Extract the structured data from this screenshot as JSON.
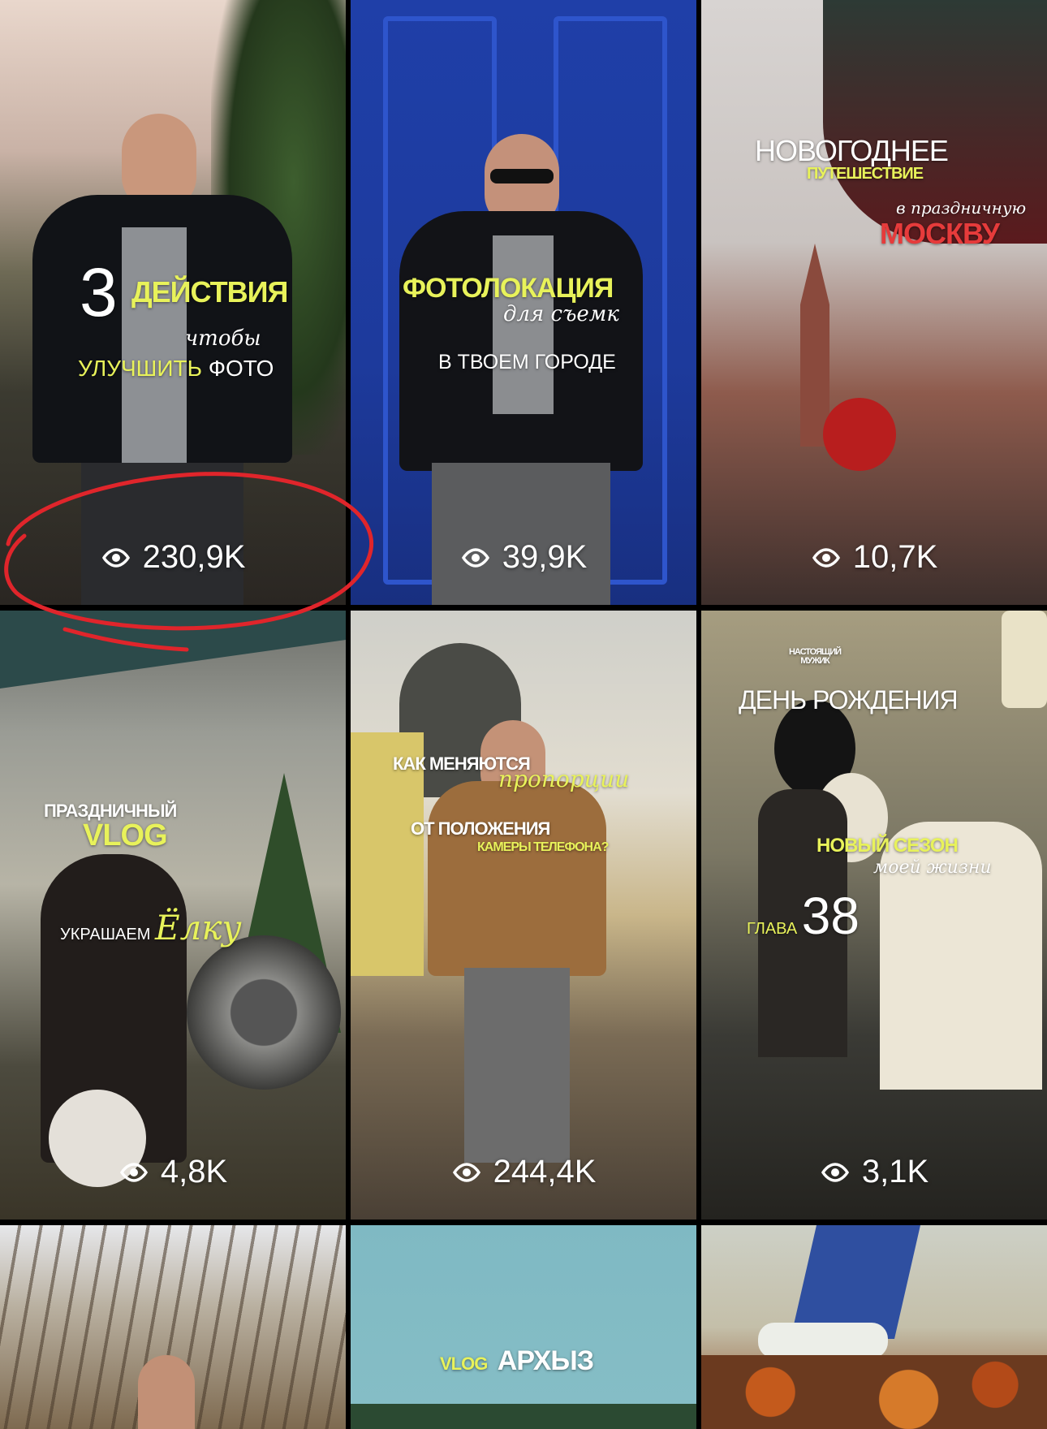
{
  "colors": {
    "accent_yellow": "#e8f25a",
    "accent_red": "#e63b3b",
    "circle_annotation": "#e0252b"
  },
  "icons": {
    "views": "eye-icon"
  },
  "tiles": [
    {
      "views": "230,9K",
      "overlay": {
        "number": "3",
        "title": "ДЕЙСТВИЯ",
        "line2": "чтобы",
        "line3a": "УЛУЧШИТЬ",
        "line3b": "ФОТО"
      }
    },
    {
      "views": "39,9K",
      "overlay": {
        "title": "ФОТОЛОКАЦИЯ",
        "line2": "для съемк",
        "line3": "В ТВОЕМ ГОРОДЕ"
      }
    },
    {
      "views": "10,7K",
      "overlay": {
        "title": "НОВОГОДНЕЕ",
        "line2": "ПУТЕШЕСТВИЕ",
        "line3": "в праздничную",
        "line4": "МОСКВУ"
      }
    },
    {
      "views": "4,8K",
      "overlay": {
        "title": "ПРАЗДНИЧНЫЙ",
        "line2": "VLOG",
        "line3a": "УКРАШАЕМ",
        "line3b": "Ёлку"
      }
    },
    {
      "views": "244,4K",
      "overlay": {
        "title": "КАК МЕНЯЮТСЯ",
        "line2": "пропорции",
        "line3": "ОТ ПОЛОЖЕНИЯ",
        "line4": "КАМЕРЫ ТЕЛЕФОНА?"
      }
    },
    {
      "views": "3,1K",
      "overlay": {
        "title": "ДЕНЬ РОЖДЕНИЯ",
        "balloon": "НАСТОЯЩИЙ МУЖИК",
        "line2": "НОВЫЙ СЕЗОН",
        "line3": "моей жизни",
        "line4a": "ГЛАВА",
        "line4b": "38"
      }
    },
    {
      "overlay": {}
    },
    {
      "overlay": {
        "title_a": "VLOG",
        "title_b": "АРХЫЗ"
      }
    },
    {
      "overlay": {}
    }
  ]
}
